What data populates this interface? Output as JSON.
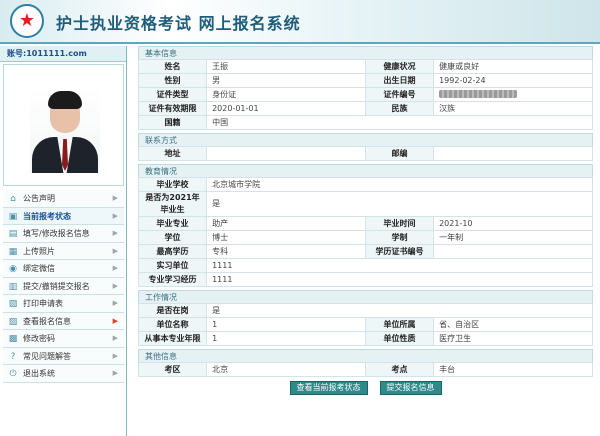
{
  "header": {
    "title": "护士执业资格考试  网上报名系统"
  },
  "sidebar": {
    "user_label": "账号:1011111.com",
    "menu": [
      {
        "label": "公告声明",
        "icon": "home-icon",
        "active": false
      },
      {
        "label": "当前报考状态",
        "icon": "status-icon",
        "active": true
      },
      {
        "label": "填写/修改报名信息",
        "icon": "form-icon",
        "active": false
      },
      {
        "label": "上传照片",
        "icon": "photo-icon",
        "active": false
      },
      {
        "label": "绑定微信",
        "icon": "wechat-icon",
        "active": false
      },
      {
        "label": "提交/撤销提交报名",
        "icon": "submit-icon",
        "active": false
      },
      {
        "label": "打印申请表",
        "icon": "print-icon",
        "active": false
      },
      {
        "label": "查看报名信息",
        "icon": "view-icon",
        "active": false
      },
      {
        "label": "修改密码",
        "icon": "password-icon",
        "active": false
      },
      {
        "label": "常见问题解答",
        "icon": "faq-icon",
        "active": false
      },
      {
        "label": "退出系统",
        "icon": "logout-icon",
        "active": false
      }
    ]
  },
  "basic": {
    "title": "基本信息",
    "name_l": "姓名",
    "name_v": "王振",
    "health_l": "健康状况",
    "health_v": "健康或良好",
    "gender_l": "性别",
    "gender_v": "男",
    "birth_l": "出生日期",
    "birth_v": "1992-02-24",
    "idtype_l": "证件类型",
    "idtype_v": "身份证",
    "idno_l": "证件编号",
    "valid_l": "证件有效期限",
    "valid_v": "2020-01-01",
    "ethnic_l": "民族",
    "ethnic_v": "汉族",
    "nation_l": "国籍",
    "nation_v": "中国"
  },
  "contact": {
    "title": "联系方式",
    "addr_l": "地址",
    "addr_v": "",
    "zip_l": "邮编",
    "zip_v": ""
  },
  "edu": {
    "title": "教育情况",
    "school_l": "毕业学校",
    "school_v": "北京城市学院",
    "after_l": "是否为2021年毕业生",
    "after_v": "是",
    "major_l": "毕业专业",
    "major_v": "助产",
    "gradtime_l": "毕业时间",
    "gradtime_v": "2021-10",
    "degree_l": "学位",
    "degree_v": "博士",
    "system_l": "学制",
    "system_v": "一年制",
    "edu_l": "最高学历",
    "edu_v": "专科",
    "cert_l": "学历证书编号",
    "cert_v": "",
    "intern_l": "实习单位",
    "intern_v": "1111",
    "study_l": "专业学习经历",
    "study_v": "1111"
  },
  "work": {
    "title": "工作情况",
    "onjob_l": "是否在岗",
    "onjob_v": "是",
    "unit_l": "单位名称",
    "unit_v": "1",
    "unitloc_l": "单位所属",
    "unitloc_v": "省、自治区",
    "years_l": "从事本专业年限",
    "years_v": "1",
    "unittype_l": "单位性质",
    "unittype_v": "医疗卫生"
  },
  "other": {
    "title": "其他信息",
    "area_l": "考区",
    "area_v": "北京",
    "site_l": "考点",
    "site_v": "丰台"
  },
  "buttons": {
    "status": "查看当前报考状态",
    "submit": "提交报名信息"
  }
}
